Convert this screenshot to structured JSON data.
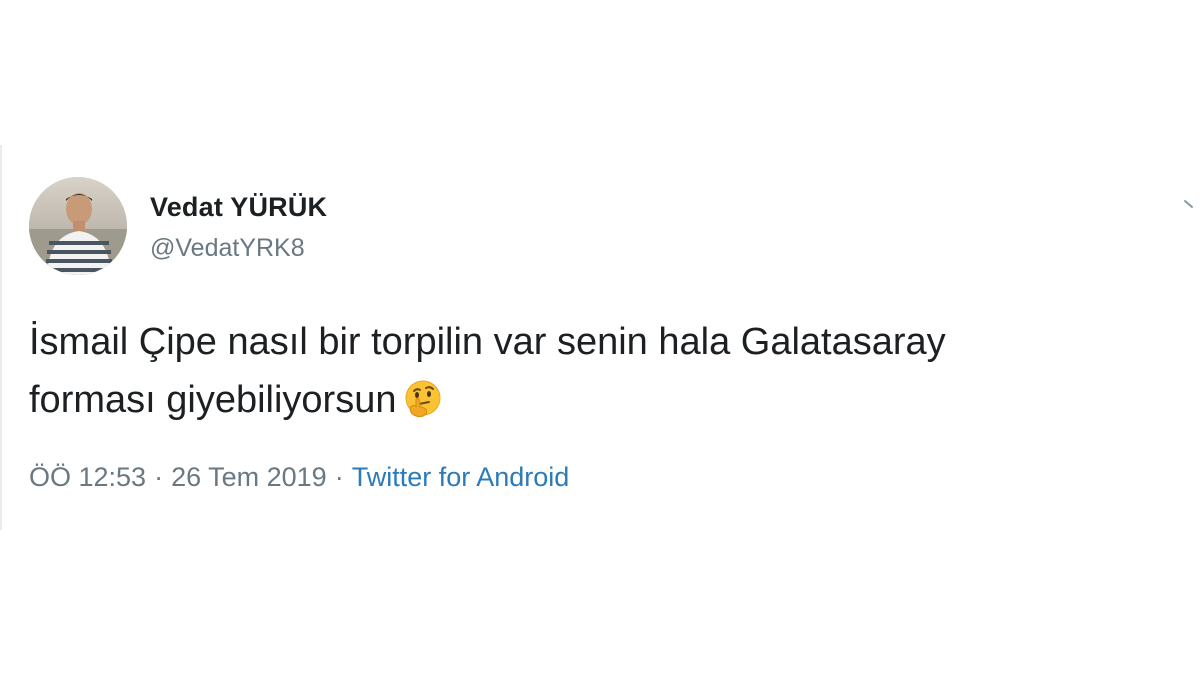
{
  "tweet": {
    "display_name": "Vedat YÜRÜK",
    "handle": "@VedatYRK8",
    "text_line1": "İsmail Çipe nasıl bir torpilin var senin hala Galatasaray",
    "text_line2": "forması giyebiliyorsun",
    "emoji_icon": "thinking-face-icon",
    "time": "ÖÖ 12:53",
    "date": "26 Tem 2019",
    "separator": "·",
    "source": "Twitter for Android"
  },
  "colors": {
    "text": "#1c2022",
    "muted": "#697882",
    "link": "#2b7bb9",
    "background": "#ffffff"
  }
}
